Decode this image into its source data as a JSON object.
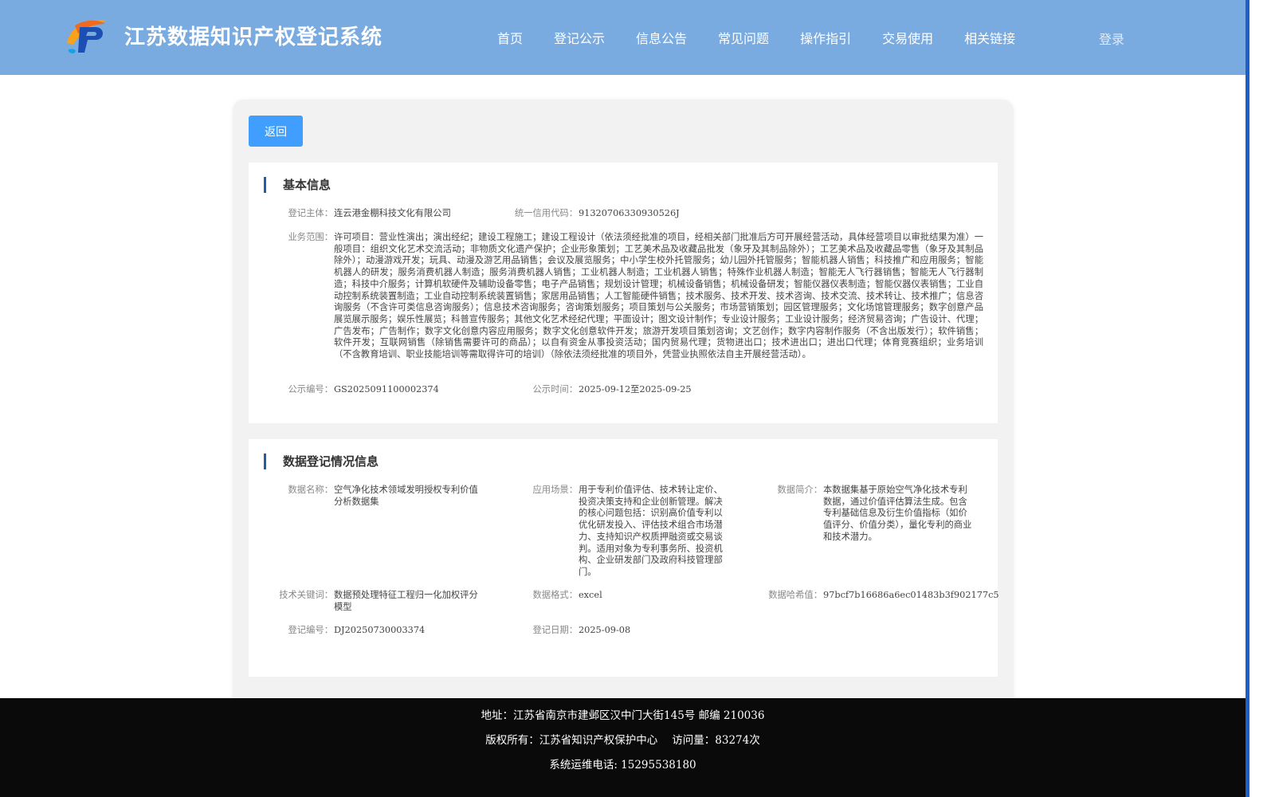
{
  "header": {
    "site_title": "江苏数据知识产权登记系统",
    "nav": [
      "首页",
      "登记公示",
      "信息公告",
      "常见问题",
      "操作指引",
      "交易使用",
      "相关链接"
    ],
    "login_label": "登录"
  },
  "colors": {
    "header_bg": "#7aabe0",
    "accent_button": "#409eff",
    "section_marker": "#1f5fa8",
    "footer_bg": "#0a0a0a"
  },
  "back_label": "返回",
  "basic": {
    "title": "基本信息",
    "entity_label": "登记主体：",
    "entity_value": "连云港金棚科技文化有限公司",
    "credit_label": "统一信用代码：",
    "credit_value": "91320706330930526J",
    "scope_label": "业务范围：",
    "scope_value": "许可项目：营业性演出；演出经纪；建设工程施工；建设工程设计（依法须经批准的项目，经相关部门批准后方可开展经营活动，具体经营项目以审批结果为准）一般项目：组织文化艺术交流活动；非物质文化遗产保护；企业形象策划；工艺美术品及收藏品批发（象牙及其制品除外）；工艺美术品及收藏品零售（象牙及其制品除外）；动漫游戏开发；玩具、动漫及游艺用品销售；会议及展览服务；中小学生校外托管服务；幼儿园外托管服务；智能机器人销售；科技推广和应用服务；智能机器人的研发；服务消费机器人制造；服务消费机器人销售；工业机器人制造；工业机器人销售；特殊作业机器人制造；智能无人飞行器销售；智能无人飞行器制造；科技中介服务；计算机软硬件及辅助设备零售；电子产品销售；规划设计管理；机械设备销售；机械设备研发；智能仪器仪表制造；智能仪器仪表销售；工业自动控制系统装置制造；工业自动控制系统装置销售；家居用品销售；人工智能硬件销售；技术服务、技术开发、技术咨询、技术交流、技术转让、技术推广；信息咨询服务（不含许可类信息咨询服务）；信息技术咨询服务；咨询策划服务；项目策划与公关服务；市场营销策划；园区管理服务；文化场馆管理服务；数字创意产品展览展示服务；娱乐性展览；科普宣传服务；其他文化艺术经纪代理；平面设计；图文设计制作；专业设计服务；工业设计服务；经济贸易咨询；广告设计、代理；广告发布；广告制作；数字文化创意内容应用服务；数字文化创意软件开发；旅游开发项目策划咨询；文艺创作；数字内容制作服务（不含出版发行）；软件销售；软件开发；互联网销售（除销售需要许可的商品）；以自有资金从事投资活动；国内贸易代理；货物进出口；技术进出口；进出口代理；体育竞赛组织；业务培训（不含教育培训、职业技能培训等需取得许可的培训）（除依法须经批准的项目外，凭营业执照依法自主开展经营活动）。",
    "pub_no_label": "公示编号：",
    "pub_no_value": "GS2025091100002374",
    "pub_time_label": "公示时间：",
    "pub_time_value": "2025-09-12至2025-09-25"
  },
  "data_reg": {
    "title": "数据登记情况信息",
    "name_label": "数据名称：",
    "name_value": "空气净化技术领域发明授权专利价值分析数据集",
    "scene_label": "应用场景：",
    "scene_value": "用于专利价值评估、技术转让定价、投资决策支持和企业创新管理。解决的核心问题包括：识别高价值专利以优化研发投入、评估技术组合市场潜力、支持知识产权质押融资或交易谈判。适用对象为专利事务所、投资机构、企业研发部门及政府科技管理部门。",
    "intro_label": "数据简介：",
    "intro_value": "本数据集基于原始空气净化技术专利数据，通过价值评估算法生成。包含专利基础信息及衍生价值指标（如价值评分、价值分类），量化专利的商业和技术潜力。",
    "keywords_label": "技术关键词：",
    "keywords_value": "数据预处理特征工程归一化加权评分模型",
    "format_label": "数据格式：",
    "format_value": "excel",
    "hash_label": "数据哈希值：",
    "hash_value": "97bcf7b16686a6ec01483b3f902177c5",
    "reg_no_label": "登记编号：",
    "reg_no_value": "DJ20250730003374",
    "reg_date_label": "登记日期：",
    "reg_date_value": "2025-09-08"
  },
  "footer": {
    "address": "地址：江苏省南京市建邺区汉中门大街145号 邮编 210036",
    "copyright": "版权所有：江苏省知识产权保护中心",
    "visits": "访问量：83274次",
    "hotline": "系统运维电话: 15295538180"
  }
}
